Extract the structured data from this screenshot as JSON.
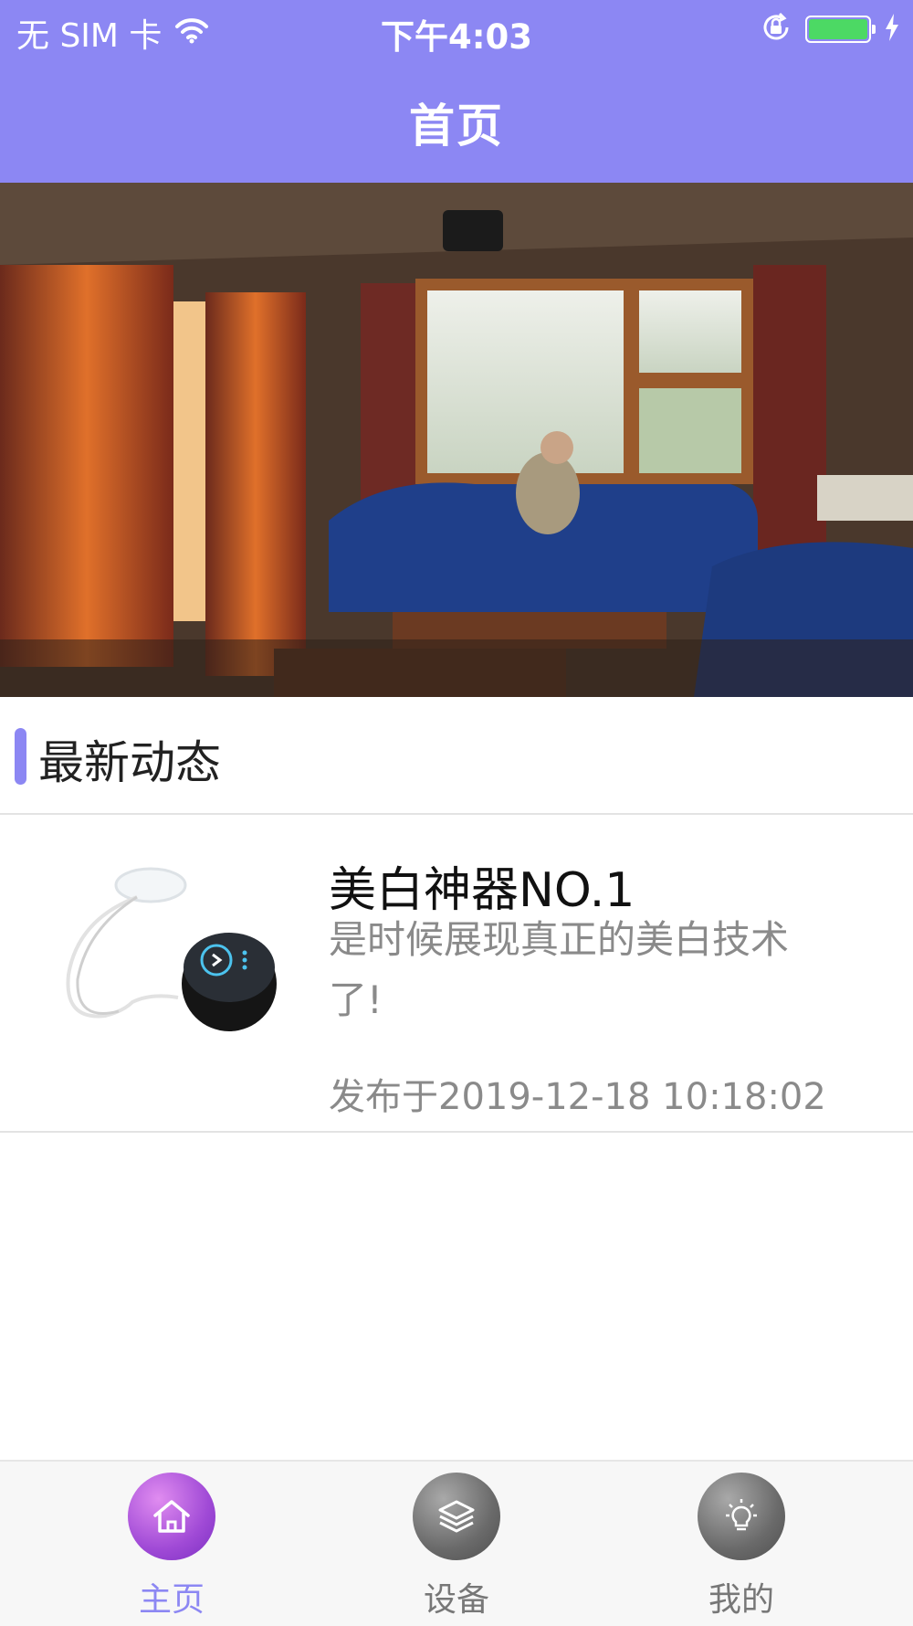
{
  "status_bar": {
    "carrier": "无 SIM 卡",
    "time": "下午4:03",
    "battery_color": "#4cd964"
  },
  "nav": {
    "title": "首页",
    "background": "#8c87f3"
  },
  "banner": {
    "icon": "living-room-photo"
  },
  "section": {
    "title": "最新动态",
    "accent": "#8c87f3"
  },
  "news": [
    {
      "title": "美白神器NO.1",
      "description": "是时候展现真正的美白技术了!",
      "published": "发布于2019-12-18 10:18:02",
      "thumbnail_icon": "teeth-whitening-device-image"
    }
  ],
  "tabs": [
    {
      "label": "主页",
      "icon": "home-icon",
      "active": true
    },
    {
      "label": "设备",
      "icon": "layers-icon",
      "active": false
    },
    {
      "label": "我的",
      "icon": "lightbulb-icon",
      "active": false
    }
  ]
}
